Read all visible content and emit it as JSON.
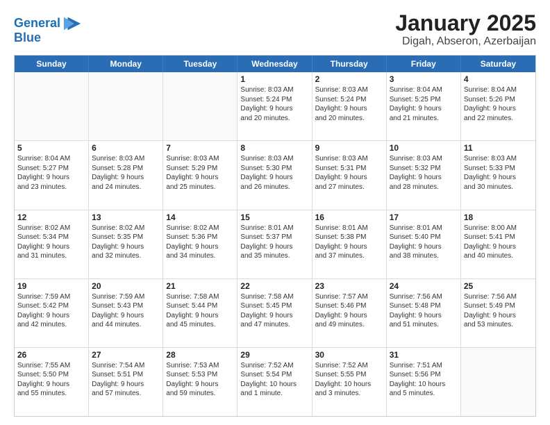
{
  "header": {
    "logo_line1": "General",
    "logo_line2": "Blue",
    "title": "January 2025",
    "subtitle": "Digah, Abseron, Azerbaijan"
  },
  "days_of_week": [
    "Sunday",
    "Monday",
    "Tuesday",
    "Wednesday",
    "Thursday",
    "Friday",
    "Saturday"
  ],
  "weeks": [
    [
      {
        "day": "",
        "info": ""
      },
      {
        "day": "",
        "info": ""
      },
      {
        "day": "",
        "info": ""
      },
      {
        "day": "1",
        "info": "Sunrise: 8:03 AM\nSunset: 5:24 PM\nDaylight: 9 hours\nand 20 minutes."
      },
      {
        "day": "2",
        "info": "Sunrise: 8:03 AM\nSunset: 5:24 PM\nDaylight: 9 hours\nand 20 minutes."
      },
      {
        "day": "3",
        "info": "Sunrise: 8:04 AM\nSunset: 5:25 PM\nDaylight: 9 hours\nand 21 minutes."
      },
      {
        "day": "4",
        "info": "Sunrise: 8:04 AM\nSunset: 5:26 PM\nDaylight: 9 hours\nand 22 minutes."
      }
    ],
    [
      {
        "day": "5",
        "info": "Sunrise: 8:04 AM\nSunset: 5:27 PM\nDaylight: 9 hours\nand 23 minutes."
      },
      {
        "day": "6",
        "info": "Sunrise: 8:03 AM\nSunset: 5:28 PM\nDaylight: 9 hours\nand 24 minutes."
      },
      {
        "day": "7",
        "info": "Sunrise: 8:03 AM\nSunset: 5:29 PM\nDaylight: 9 hours\nand 25 minutes."
      },
      {
        "day": "8",
        "info": "Sunrise: 8:03 AM\nSunset: 5:30 PM\nDaylight: 9 hours\nand 26 minutes."
      },
      {
        "day": "9",
        "info": "Sunrise: 8:03 AM\nSunset: 5:31 PM\nDaylight: 9 hours\nand 27 minutes."
      },
      {
        "day": "10",
        "info": "Sunrise: 8:03 AM\nSunset: 5:32 PM\nDaylight: 9 hours\nand 28 minutes."
      },
      {
        "day": "11",
        "info": "Sunrise: 8:03 AM\nSunset: 5:33 PM\nDaylight: 9 hours\nand 30 minutes."
      }
    ],
    [
      {
        "day": "12",
        "info": "Sunrise: 8:02 AM\nSunset: 5:34 PM\nDaylight: 9 hours\nand 31 minutes."
      },
      {
        "day": "13",
        "info": "Sunrise: 8:02 AM\nSunset: 5:35 PM\nDaylight: 9 hours\nand 32 minutes."
      },
      {
        "day": "14",
        "info": "Sunrise: 8:02 AM\nSunset: 5:36 PM\nDaylight: 9 hours\nand 34 minutes."
      },
      {
        "day": "15",
        "info": "Sunrise: 8:01 AM\nSunset: 5:37 PM\nDaylight: 9 hours\nand 35 minutes."
      },
      {
        "day": "16",
        "info": "Sunrise: 8:01 AM\nSunset: 5:38 PM\nDaylight: 9 hours\nand 37 minutes."
      },
      {
        "day": "17",
        "info": "Sunrise: 8:01 AM\nSunset: 5:40 PM\nDaylight: 9 hours\nand 38 minutes."
      },
      {
        "day": "18",
        "info": "Sunrise: 8:00 AM\nSunset: 5:41 PM\nDaylight: 9 hours\nand 40 minutes."
      }
    ],
    [
      {
        "day": "19",
        "info": "Sunrise: 7:59 AM\nSunset: 5:42 PM\nDaylight: 9 hours\nand 42 minutes."
      },
      {
        "day": "20",
        "info": "Sunrise: 7:59 AM\nSunset: 5:43 PM\nDaylight: 9 hours\nand 44 minutes."
      },
      {
        "day": "21",
        "info": "Sunrise: 7:58 AM\nSunset: 5:44 PM\nDaylight: 9 hours\nand 45 minutes."
      },
      {
        "day": "22",
        "info": "Sunrise: 7:58 AM\nSunset: 5:45 PM\nDaylight: 9 hours\nand 47 minutes."
      },
      {
        "day": "23",
        "info": "Sunrise: 7:57 AM\nSunset: 5:46 PM\nDaylight: 9 hours\nand 49 minutes."
      },
      {
        "day": "24",
        "info": "Sunrise: 7:56 AM\nSunset: 5:48 PM\nDaylight: 9 hours\nand 51 minutes."
      },
      {
        "day": "25",
        "info": "Sunrise: 7:56 AM\nSunset: 5:49 PM\nDaylight: 9 hours\nand 53 minutes."
      }
    ],
    [
      {
        "day": "26",
        "info": "Sunrise: 7:55 AM\nSunset: 5:50 PM\nDaylight: 9 hours\nand 55 minutes."
      },
      {
        "day": "27",
        "info": "Sunrise: 7:54 AM\nSunset: 5:51 PM\nDaylight: 9 hours\nand 57 minutes."
      },
      {
        "day": "28",
        "info": "Sunrise: 7:53 AM\nSunset: 5:53 PM\nDaylight: 9 hours\nand 59 minutes."
      },
      {
        "day": "29",
        "info": "Sunrise: 7:52 AM\nSunset: 5:54 PM\nDaylight: 10 hours\nand 1 minute."
      },
      {
        "day": "30",
        "info": "Sunrise: 7:52 AM\nSunset: 5:55 PM\nDaylight: 10 hours\nand 3 minutes."
      },
      {
        "day": "31",
        "info": "Sunrise: 7:51 AM\nSunset: 5:56 PM\nDaylight: 10 hours\nand 5 minutes."
      },
      {
        "day": "",
        "info": ""
      }
    ]
  ]
}
